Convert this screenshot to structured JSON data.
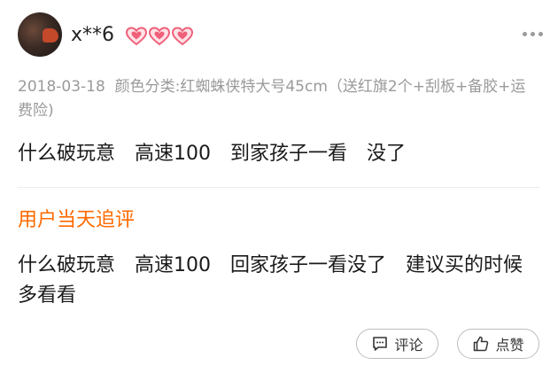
{
  "user": {
    "name": "x**6",
    "badge": "heart-level-badges"
  },
  "review": {
    "date": "2018-03-18",
    "sku_label": "颜色分类:",
    "sku_value": "红蜘蛛侠特大号45cm（送红旗2个+刮板+备胶+运费险)",
    "text": "什么破玩意　高速100　到家孩子一看　没了"
  },
  "followup": {
    "title": "用户当天追评",
    "text": "什么破玩意　高速100　回家孩子一看没了　建议买的时候多看看"
  },
  "actions": {
    "comment_label": "评论",
    "like_label": "点赞"
  },
  "colors": {
    "accent": "#ff6a00",
    "meta": "#9a9a9a",
    "heart": "#f0607a"
  }
}
